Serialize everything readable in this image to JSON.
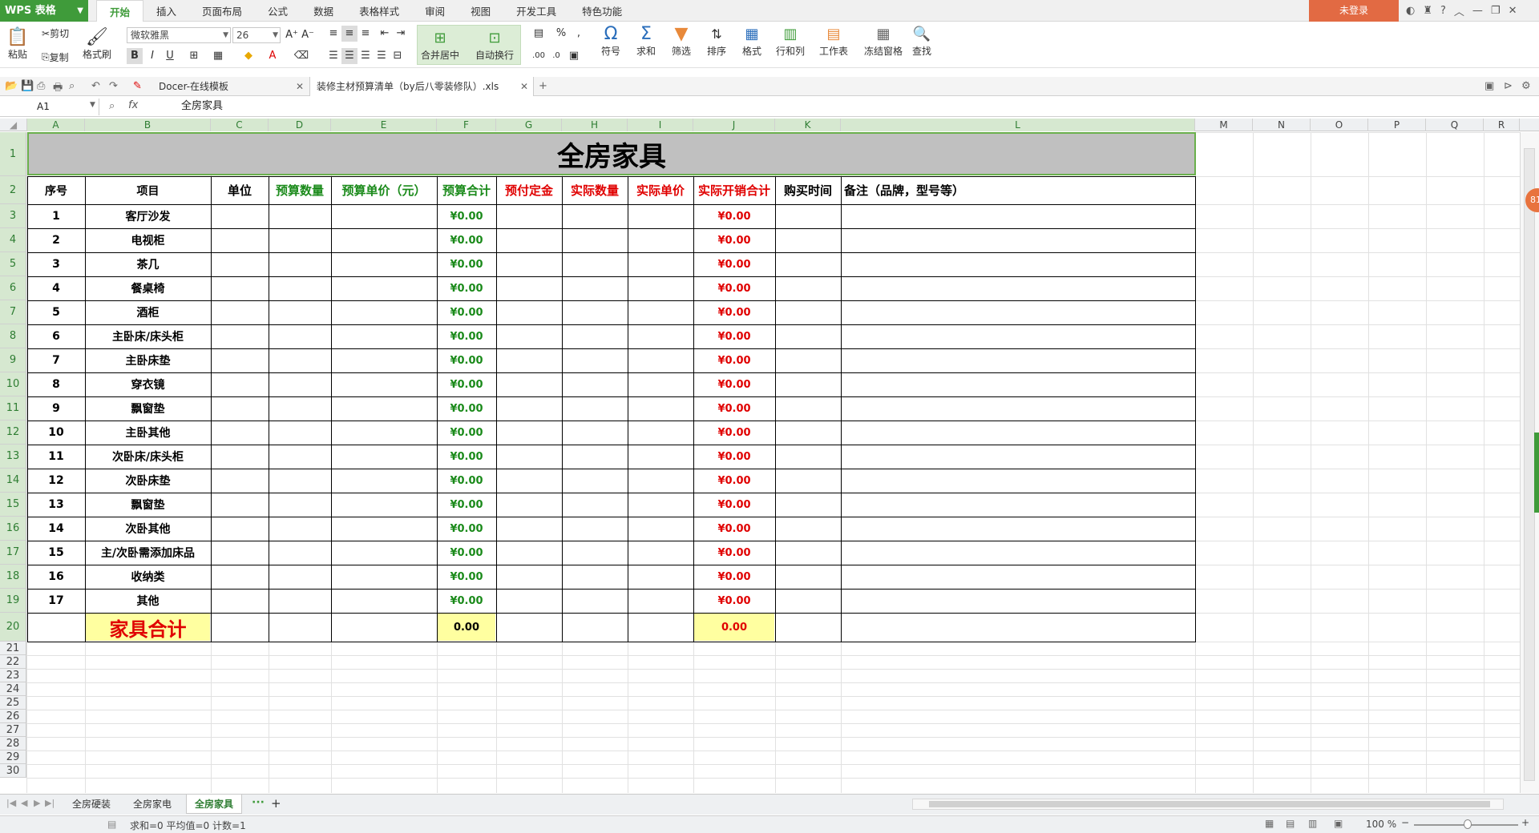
{
  "app": {
    "name": "WPS 表格",
    "login": "未登录"
  },
  "menu": [
    "开始",
    "插入",
    "页面布局",
    "公式",
    "数据",
    "表格样式",
    "审阅",
    "视图",
    "开发工具",
    "特色功能"
  ],
  "ribbon": {
    "paste": "粘贴",
    "cut": "剪切",
    "copy": "复制",
    "format_painter": "格式刷",
    "font_name": "微软雅黑",
    "font_size": "26",
    "merge_center": "合并居中",
    "wrap_text": "自动换行",
    "symbol": "符号",
    "sum": "求和",
    "filter": "筛选",
    "sort": "排序",
    "format": "格式",
    "rows_cols": "行和列",
    "worksheet": "工作表",
    "freeze": "冻结窗格",
    "find": "查找"
  },
  "doc_tabs": [
    "Docer-在线模板",
    "装修主材预算清单（by后八零装修队）.xls"
  ],
  "formula_bar": {
    "name_box": "A1",
    "fx": "fx",
    "content": "全房家具"
  },
  "columns": [
    "A",
    "B",
    "C",
    "D",
    "E",
    "F",
    "G",
    "H",
    "I",
    "J",
    "K",
    "L",
    "M",
    "N",
    "O",
    "P",
    "Q",
    "R"
  ],
  "rows": [
    "1",
    "2",
    "3",
    "4",
    "5",
    "6",
    "7",
    "8",
    "9",
    "10",
    "11",
    "12",
    "13",
    "14",
    "15",
    "16",
    "17",
    "18",
    "19",
    "20",
    "21",
    "22",
    "23",
    "24",
    "25",
    "26",
    "27",
    "28",
    "29",
    "30"
  ],
  "sheet": {
    "title": "全房家具",
    "headers": [
      "序号",
      "项目",
      "单位",
      "预算数量",
      "预算单价（元）",
      "预算合计",
      "预付定金",
      "实际数量",
      "实际单价",
      "实际开销合计",
      "购买时间",
      "备注（品牌，型号等）"
    ],
    "items": [
      {
        "no": "1",
        "name": "客厅沙发",
        "budget": "¥0.00",
        "actual": "¥0.00"
      },
      {
        "no": "2",
        "name": "电视柜",
        "budget": "¥0.00",
        "actual": "¥0.00"
      },
      {
        "no": "3",
        "name": "茶几",
        "budget": "¥0.00",
        "actual": "¥0.00"
      },
      {
        "no": "4",
        "name": "餐桌椅",
        "budget": "¥0.00",
        "actual": "¥0.00"
      },
      {
        "no": "5",
        "name": "酒柜",
        "budget": "¥0.00",
        "actual": "¥0.00"
      },
      {
        "no": "6",
        "name": "主卧床/床头柜",
        "budget": "¥0.00",
        "actual": "¥0.00"
      },
      {
        "no": "7",
        "name": "主卧床垫",
        "budget": "¥0.00",
        "actual": "¥0.00"
      },
      {
        "no": "8",
        "name": "穿衣镜",
        "budget": "¥0.00",
        "actual": "¥0.00"
      },
      {
        "no": "9",
        "name": "飘窗垫",
        "budget": "¥0.00",
        "actual": "¥0.00"
      },
      {
        "no": "10",
        "name": "主卧其他",
        "budget": "¥0.00",
        "actual": "¥0.00"
      },
      {
        "no": "11",
        "name": "次卧床/床头柜",
        "budget": "¥0.00",
        "actual": "¥0.00"
      },
      {
        "no": "12",
        "name": "次卧床垫",
        "budget": "¥0.00",
        "actual": "¥0.00"
      },
      {
        "no": "13",
        "name": "飘窗垫",
        "budget": "¥0.00",
        "actual": "¥0.00"
      },
      {
        "no": "14",
        "name": "次卧其他",
        "budget": "¥0.00",
        "actual": "¥0.00"
      },
      {
        "no": "15",
        "name": "主/次卧需添加床品",
        "budget": "¥0.00",
        "actual": "¥0.00"
      },
      {
        "no": "16",
        "name": "收纳类",
        "budget": "¥0.00",
        "actual": "¥0.00"
      },
      {
        "no": "17",
        "name": "其他",
        "budget": "¥0.00",
        "actual": "¥0.00"
      }
    ],
    "total": {
      "label": "家具合计",
      "budget": "0.00",
      "actual": "0.00"
    }
  },
  "sheet_tabs": [
    "全房硬装",
    "全房家电",
    "全房家具"
  ],
  "status": {
    "summary": "求和=0  平均值=0  计数=1",
    "zoom": "100 %",
    "float_badge": "81"
  },
  "colors": {
    "green": "#1a8a1a",
    "red": "#e00000",
    "brand": "#3f9b3a"
  }
}
